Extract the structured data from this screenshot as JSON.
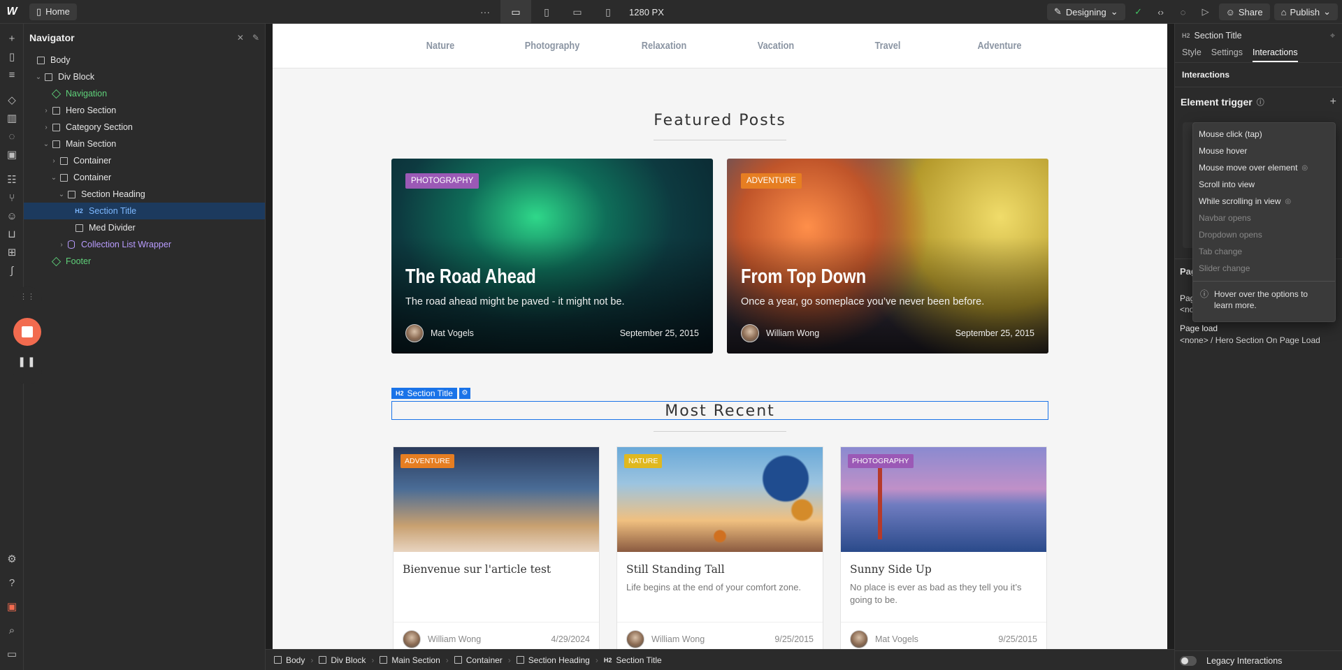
{
  "topbar": {
    "page_name": "Home",
    "more": "···",
    "width": "1280 PX",
    "mode": "Designing",
    "share": "Share",
    "publish": "Publish"
  },
  "navigator": {
    "title": "Navigator",
    "items": [
      {
        "label": "Body",
        "icon": "box-icon",
        "type": "box"
      },
      {
        "label": "Div Block",
        "icon": "box-icon",
        "type": "box"
      },
      {
        "label": "Navigation",
        "icon": "symbol-icon",
        "type": "symbol"
      },
      {
        "label": "Hero Section",
        "icon": "section-icon",
        "type": "section"
      },
      {
        "label": "Category Section",
        "icon": "section-icon",
        "type": "section"
      },
      {
        "label": "Main Section",
        "icon": "section-icon",
        "type": "section"
      },
      {
        "label": "Container",
        "icon": "container-icon",
        "type": "container"
      },
      {
        "label": "Container",
        "icon": "container-icon",
        "type": "container"
      },
      {
        "label": "Section Heading",
        "icon": "box-icon",
        "type": "box"
      },
      {
        "label": "Section Title",
        "icon": "h2-icon",
        "type": "heading"
      },
      {
        "label": "Med Divider",
        "icon": "box-icon",
        "type": "box"
      },
      {
        "label": "Collection List Wrapper",
        "icon": "collection-icon",
        "type": "collection"
      },
      {
        "label": "Footer",
        "icon": "symbol-icon",
        "type": "symbol"
      }
    ]
  },
  "canvas": {
    "nav_links": [
      "Nature",
      "Photography",
      "Relaxation",
      "Vacation",
      "Travel",
      "Adventure"
    ],
    "featured_title": "Featured Posts",
    "featured": [
      {
        "tag": "PHOTOGRAPHY",
        "title": "The Road Ahead",
        "subtitle": "The road ahead might be paved - it might not be.",
        "author": "Mat Vogels",
        "date": "September 25, 2015"
      },
      {
        "tag": "ADVENTURE",
        "title": "From Top Down",
        "subtitle": "Once a year, go someplace you’ve never been before.",
        "author": "William Wong",
        "date": "September 25, 2015"
      }
    ],
    "selection_label": "Section Title",
    "selection_tag": "H2",
    "recent_title": "Most Recent",
    "recent": [
      {
        "tag": "ADVENTURE",
        "title": "Bienvenue sur l'article test",
        "subtitle": "",
        "author": "William Wong",
        "date": "4/29/2024"
      },
      {
        "tag": "NATURE",
        "title": "Still Standing Tall",
        "subtitle": "Life begins at the end of your comfort zone.",
        "author": "William Wong",
        "date": "9/25/2015"
      },
      {
        "tag": "PHOTOGRAPHY",
        "title": "Sunny Side Up",
        "subtitle": "No place is ever as bad as they tell you it’s going to be.",
        "author": "Mat Vogels",
        "date": "9/25/2015"
      }
    ]
  },
  "right_panel": {
    "element_tag": "H2",
    "element_name": "Section Title",
    "tabs": [
      "Style",
      "Settings",
      "Interactions"
    ],
    "active_tab": "Interactions",
    "section_label": "Interactions",
    "element_trigger": "Element trigger",
    "trigger_options": [
      {
        "label": "Mouse click (tap)",
        "enabled": true
      },
      {
        "label": "Mouse hover",
        "enabled": true
      },
      {
        "label": "Mouse move over element",
        "enabled": true
      },
      {
        "label": "Scroll into view",
        "enabled": true
      },
      {
        "label": "While scrolling in view",
        "enabled": true
      },
      {
        "label": "Navbar opens",
        "enabled": false
      },
      {
        "label": "Dropdown opens",
        "enabled": false
      },
      {
        "label": "Tab change",
        "enabled": false
      },
      {
        "label": "Slider change",
        "enabled": false
      }
    ],
    "help_text": "Hover over the options to learn more.",
    "page_trigger_partial": "Pag",
    "page_trigger_row_partial": "Pag",
    "page_trigger_value_partial": "<no",
    "page_load_label": "Page load",
    "page_load_value": "<none> / Hero Section On Page Load",
    "legacy": "Legacy Interactions"
  },
  "breadcrumb": [
    {
      "label": "Body"
    },
    {
      "label": "Div Block"
    },
    {
      "label": "Main Section"
    },
    {
      "label": "Container"
    },
    {
      "label": "Section Heading"
    },
    {
      "label": "Section Title",
      "tag": "H2"
    }
  ],
  "colors": {
    "accent": "#1a73e8",
    "tag_photography": "#9b59b6",
    "tag_adventure": "#e67e22",
    "tag_nature": "#e0b81f",
    "record": "#f26b4f"
  }
}
